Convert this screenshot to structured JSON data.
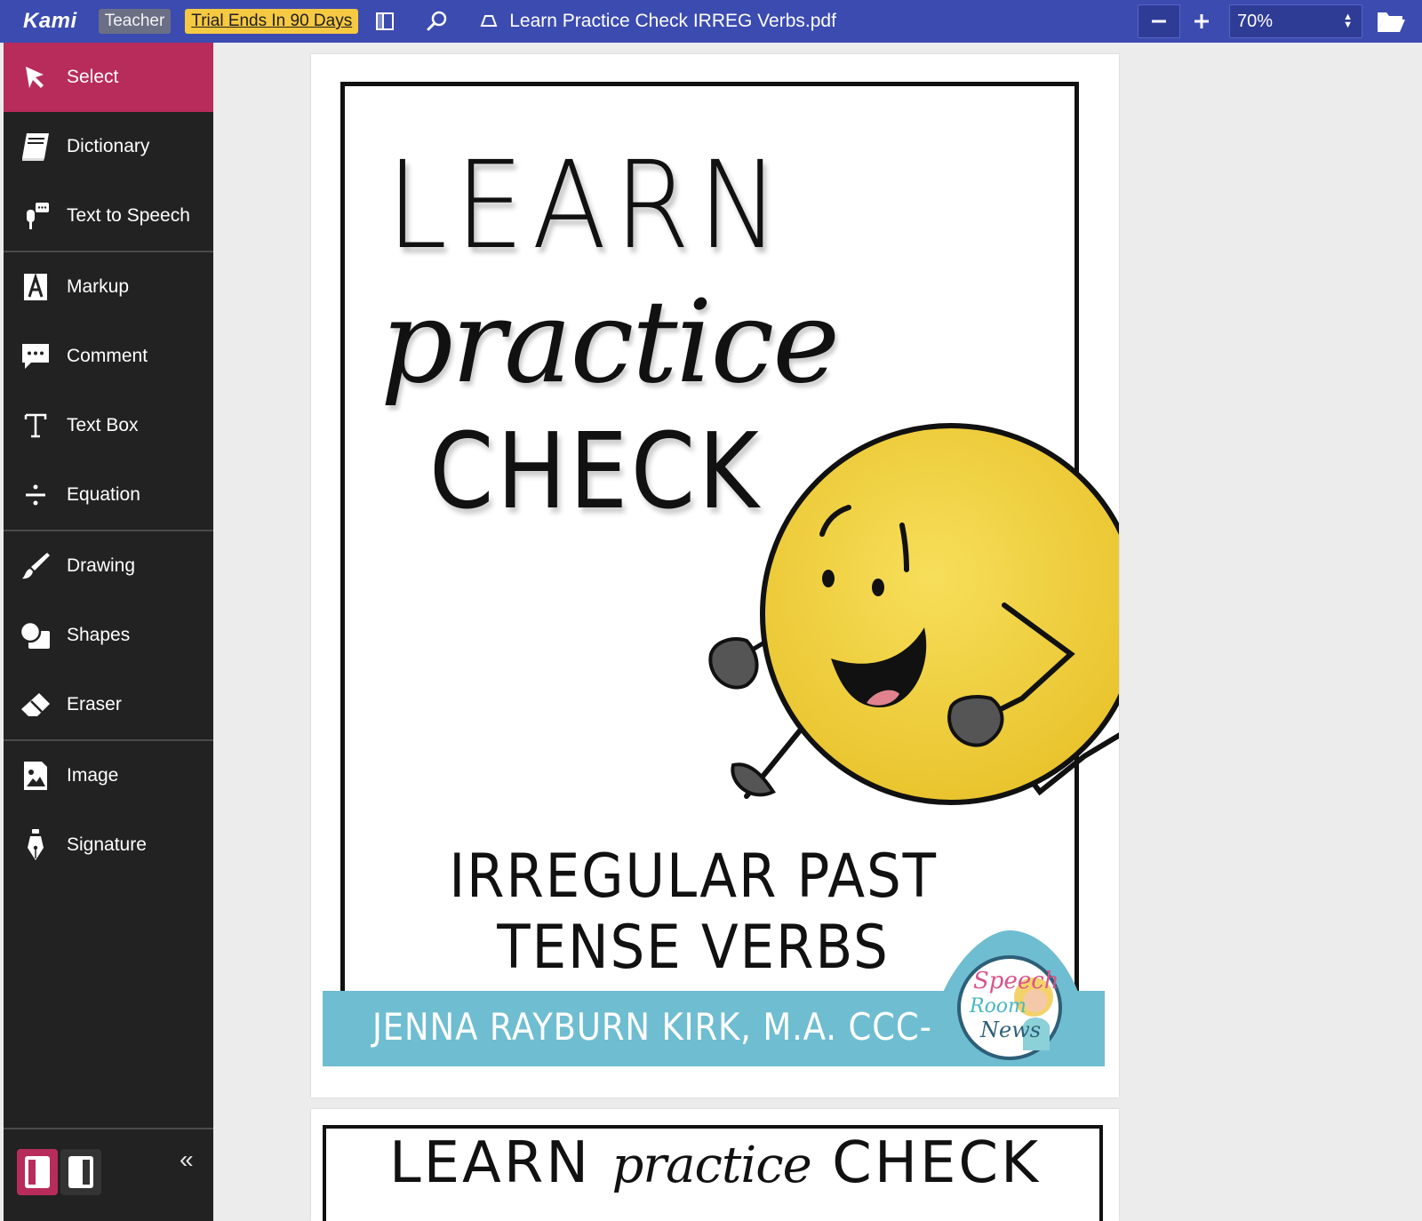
{
  "topbar": {
    "logo": "Kami",
    "role": "Teacher",
    "trial": "Trial Ends In 90 Days",
    "document_title": "Learn Practice Check IRREG Verbs.pdf",
    "zoom_level": "70%"
  },
  "sidebar": {
    "items": [
      {
        "label": "Select",
        "icon": "cursor-arrow-icon",
        "active": true
      },
      {
        "label": "Dictionary",
        "icon": "book-icon"
      },
      {
        "label": "Text to Speech",
        "icon": "speaker-icon"
      },
      {
        "label": "Markup",
        "icon": "highlighter-icon"
      },
      {
        "label": "Comment",
        "icon": "comment-bubble-icon"
      },
      {
        "label": "Text Box",
        "icon": "text-t-icon"
      },
      {
        "label": "Equation",
        "icon": "divide-icon"
      },
      {
        "label": "Drawing",
        "icon": "brush-icon"
      },
      {
        "label": "Shapes",
        "icon": "shapes-icon"
      },
      {
        "label": "Eraser",
        "icon": "eraser-icon"
      },
      {
        "label": "Image",
        "icon": "image-icon"
      },
      {
        "label": "Signature",
        "icon": "pen-nib-icon"
      }
    ],
    "collapse": "«"
  },
  "document": {
    "page1": {
      "title_line1": "LEARN",
      "title_line2": "practice",
      "title_line3": "CHECK",
      "subtitle_line1": "IRREGULAR PAST",
      "subtitle_line2": "TENSE VERBS",
      "author": "JENNA RAYBURN KIRK, M.A. CCC-SLP",
      "logo_text": [
        "Speech",
        "Room",
        "News"
      ]
    },
    "page2": {
      "title_word1": "LEARN",
      "title_word2": "practice",
      "title_word3": "CHECK"
    }
  },
  "colors": {
    "topbar": "#3c4bb0",
    "sidebar": "#222222",
    "active_tool": "#b82c5c",
    "trial_badge": "#f6c942",
    "banner": "#6fbdd1",
    "mascot": "#f2d03b"
  }
}
